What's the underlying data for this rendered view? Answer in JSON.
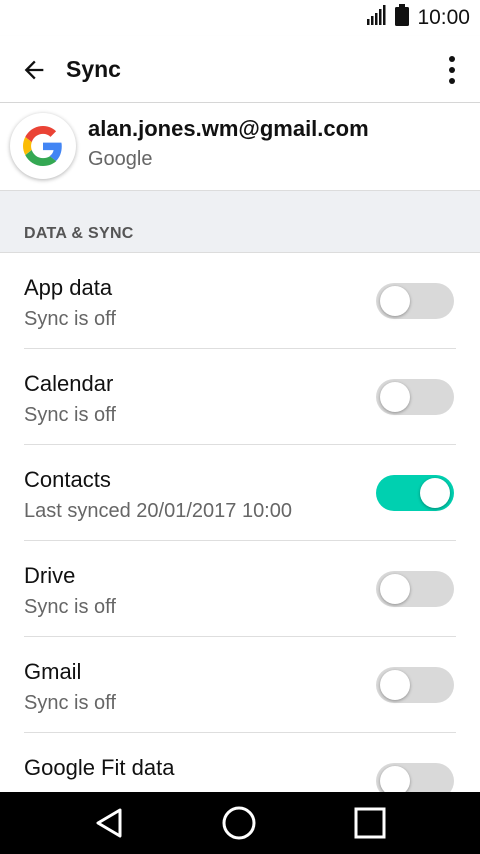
{
  "status_bar": {
    "time": "10:00"
  },
  "app_bar": {
    "title": "Sync"
  },
  "account": {
    "email": "alan.jones.wm@gmail.com",
    "type": "Google"
  },
  "section": {
    "label": "DATA & SYNC"
  },
  "items": [
    {
      "title": "App data",
      "subtitle": "Sync is off",
      "on": false
    },
    {
      "title": "Calendar",
      "subtitle": "Sync is off",
      "on": false
    },
    {
      "title": "Contacts",
      "subtitle": "Last synced 20/01/2017 10:00",
      "on": true
    },
    {
      "title": "Drive",
      "subtitle": "Sync is off",
      "on": false
    },
    {
      "title": "Gmail",
      "subtitle": "Sync is off",
      "on": false
    },
    {
      "title": "Google Fit data",
      "subtitle": "",
      "on": false
    }
  ],
  "colors": {
    "accent": "#00d0b0",
    "toggle_off": "#d9d9d9"
  }
}
